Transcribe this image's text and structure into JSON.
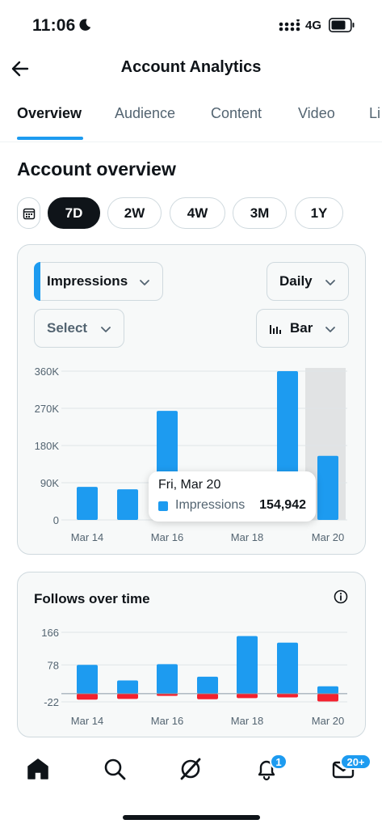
{
  "status_bar": {
    "time": "11:06",
    "network": "4G"
  },
  "header": {
    "title": "Account Analytics"
  },
  "tabs": [
    {
      "label": "Overview",
      "active": true
    },
    {
      "label": "Audience",
      "active": false
    },
    {
      "label": "Content",
      "active": false
    },
    {
      "label": "Video",
      "active": false
    },
    {
      "label": "Li",
      "active": false
    }
  ],
  "section": {
    "title": "Account overview"
  },
  "ranges": [
    {
      "label": "7D",
      "active": true
    },
    {
      "label": "2W",
      "active": false
    },
    {
      "label": "4W",
      "active": false
    },
    {
      "label": "3M",
      "active": false
    },
    {
      "label": "1Y",
      "active": false
    }
  ],
  "impressions_card": {
    "metric_select": "Impressions",
    "interval_select": "Daily",
    "compare_select": "Select",
    "chart_type_select": "Bar"
  },
  "tooltip": {
    "date": "Fri, Mar 20",
    "series": "Impressions",
    "value": "154,942"
  },
  "follows_card": {
    "title": "Follows over time"
  },
  "nav": {
    "notifications_badge": "1",
    "messages_badge": "20+"
  },
  "colors": {
    "accent": "#1d9bf0",
    "negative": "#f4212e",
    "text": "#0f1419",
    "muted": "#536471"
  },
  "chart_data": [
    {
      "type": "bar",
      "categories": [
        "Mar 14",
        "Mar 15",
        "Mar 16",
        "Mar 17",
        "Mar 18",
        "Mar 19",
        "Mar 20"
      ],
      "x_tick_labels": [
        "Mar 14",
        "Mar 16",
        "Mar 18",
        "Mar 20"
      ],
      "series": [
        {
          "name": "Impressions",
          "values": [
            80000,
            74000,
            264000,
            2000,
            2000,
            360000,
            154942
          ]
        }
      ],
      "y_ticks": [
        "360K",
        "270K",
        "180K",
        "90K",
        "0"
      ],
      "ylim": [
        0,
        360000
      ],
      "highlighted_category": "Mar 20",
      "grid": true
    },
    {
      "type": "bar",
      "title": "Follows over time",
      "categories": [
        "Mar 14",
        "Mar 15",
        "Mar 16",
        "Mar 17",
        "Mar 18",
        "Mar 19",
        "Mar 20"
      ],
      "x_tick_labels": [
        "Mar 14",
        "Mar 16",
        "Mar 18",
        "Mar 20"
      ],
      "series": [
        {
          "name": "Follows",
          "values": [
            78,
            36,
            80,
            46,
            156,
            138,
            20
          ]
        },
        {
          "name": "Unfollows",
          "values": [
            -16,
            -14,
            -6,
            -15,
            -12,
            -10,
            -21
          ]
        }
      ],
      "y_ticks": [
        "166",
        "78",
        "-22"
      ],
      "ylim": [
        -22,
        166
      ],
      "grid": true
    }
  ]
}
